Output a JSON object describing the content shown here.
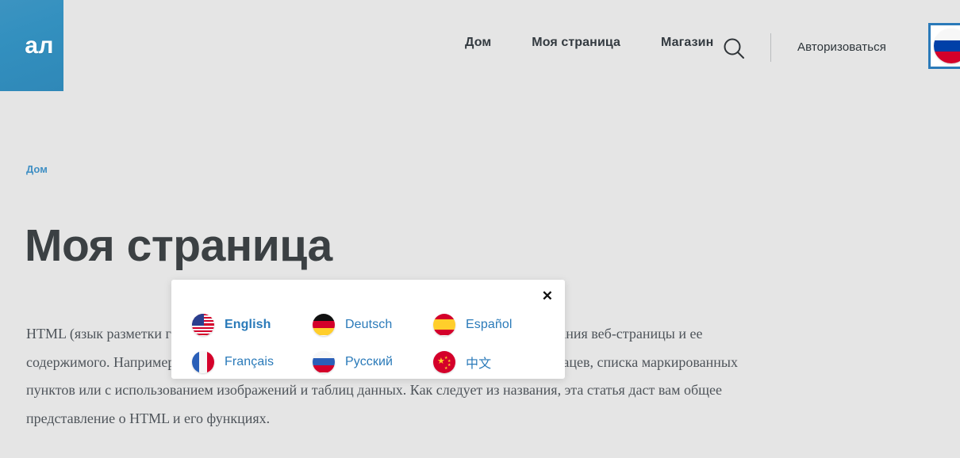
{
  "header": {
    "logo_text": "ал",
    "logo_color": "#3390bf",
    "nav": [
      {
        "label": "Дом",
        "name": "nav-item-home"
      },
      {
        "label": "Моя страница",
        "name": "nav-item-my-page"
      },
      {
        "label": "Магазин",
        "name": "nav-item-shop"
      }
    ],
    "search_icon": "search-icon",
    "signin_label": "Авторизоваться",
    "lang_button_icon": "flag-ru-icon",
    "lang_button_border_color": "#2a7ab9"
  },
  "breadcrumb": {
    "label": "Дом",
    "color": "#3f8fc4"
  },
  "page": {
    "title": "Моя страница",
    "title_color": "#3b4043",
    "background_color": "#e5e5e5",
    "paragraph": "HTML (язык разметки гипертекста) — это код, который используется для структурирования веб-страницы и ее содержимого. Например, содержимое может быть структурировано в рамках набора абзацев, списка маркированных пунктов или с использованием изображений и таблиц данных. Как следует из названия, эта статья даст вам общее представление о HTML и его функциях."
  },
  "modal": {
    "close_label": "✕",
    "accent_color": "#2a7ab9",
    "languages": [
      {
        "label": "English",
        "flag": "flag-us-icon",
        "active": true,
        "name": "language-option-english"
      },
      {
        "label": "Deutsch",
        "flag": "flag-de-icon",
        "active": false,
        "name": "language-option-deutsch"
      },
      {
        "label": "Español",
        "flag": "flag-es-icon",
        "active": false,
        "name": "language-option-espanol"
      },
      {
        "label": "Français",
        "flag": "flag-fr-icon",
        "active": false,
        "name": "language-option-francais"
      },
      {
        "label": "Русский",
        "flag": "flag-ru-icon",
        "active": false,
        "name": "language-option-russian"
      },
      {
        "label": "中文",
        "flag": "flag-cn-icon",
        "active": false,
        "name": "language-option-chinese"
      }
    ]
  }
}
